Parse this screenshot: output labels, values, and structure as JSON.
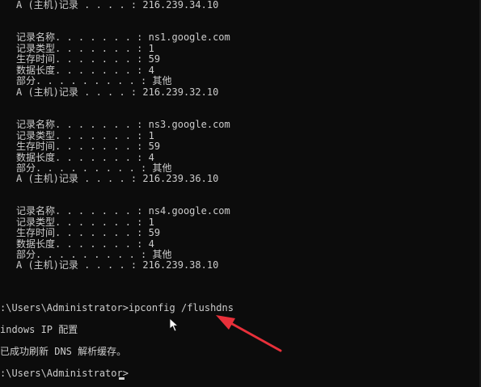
{
  "terminal": {
    "top_record_line": "A (主机)记录 . . . . : 216.239.34.10",
    "records": [
      {
        "name": "记录名称. . . . . . . : ns1.google.com",
        "type": "记录类型. . . . . . . : 1",
        "ttl": "生存时间. . . . . . . : 59",
        "length": "数据长度. . . . . . . : 4",
        "section": "部分. . . . . . . . . : 其他",
        "a_record": "A (主机)记录 . . . . : 216.239.32.10"
      },
      {
        "name": "记录名称. . . . . . . : ns3.google.com",
        "type": "记录类型. . . . . . . : 1",
        "ttl": "生存时间. . . . . . . : 59",
        "length": "数据长度. . . . . . . : 4",
        "section": "部分. . . . . . . . . : 其他",
        "a_record": "A (主机)记录 . . . . : 216.239.36.10"
      },
      {
        "name": "记录名称. . . . . . . : ns4.google.com",
        "type": "记录类型. . . . . . . : 1",
        "ttl": "生存时间. . . . . . . : 59",
        "length": "数据长度. . . . . . . : 4",
        "section": "部分. . . . . . . . . : 其他",
        "a_record": "A (主机)记录 . . . . : 216.239.38.10"
      }
    ],
    "command_line": ":\\Users\\Administrator>ipconfig /flushdns",
    "windows_ip_config": "indows IP 配置",
    "flush_success": "已成功刷新 DNS 解析缓存。",
    "prompt_line": ":\\Users\\Administrator>"
  },
  "colors": {
    "background": "#0c0c0c",
    "text": "#cccccc",
    "annotation_arrow": "#e8303a",
    "mouse_pointer": "#ffffff"
  },
  "icons": {
    "pointer": "mouse-pointer-icon",
    "arrow": "annotation-arrow-icon"
  }
}
